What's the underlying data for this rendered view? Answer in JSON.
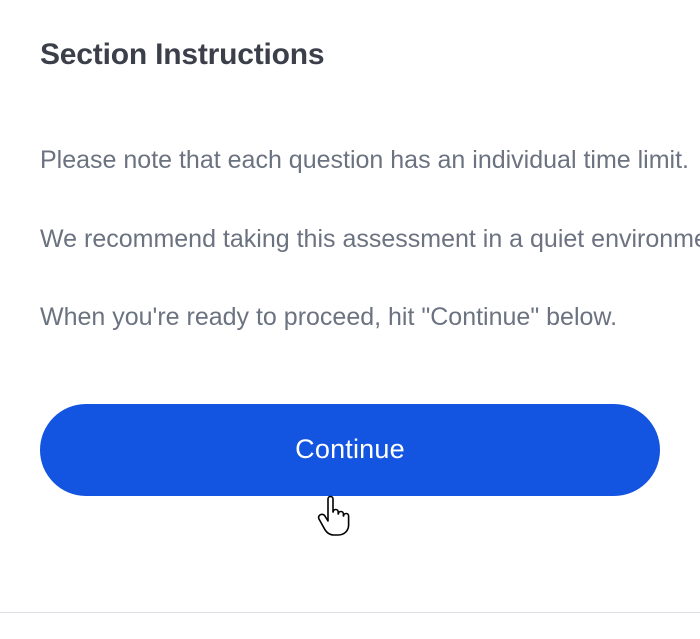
{
  "heading": "Section Instructions",
  "instructions": [
    "Please note that each question has an individual time limit.",
    "We recommend taking this assessment in a quiet environment.",
    "When you're ready to proceed, hit \"Continue\" below."
  ],
  "button": {
    "continue_label": "Continue"
  },
  "colors": {
    "heading": "#3b3f4a",
    "body_text": "#6b7280",
    "button_bg": "#1355e0",
    "button_text": "#ffffff"
  }
}
